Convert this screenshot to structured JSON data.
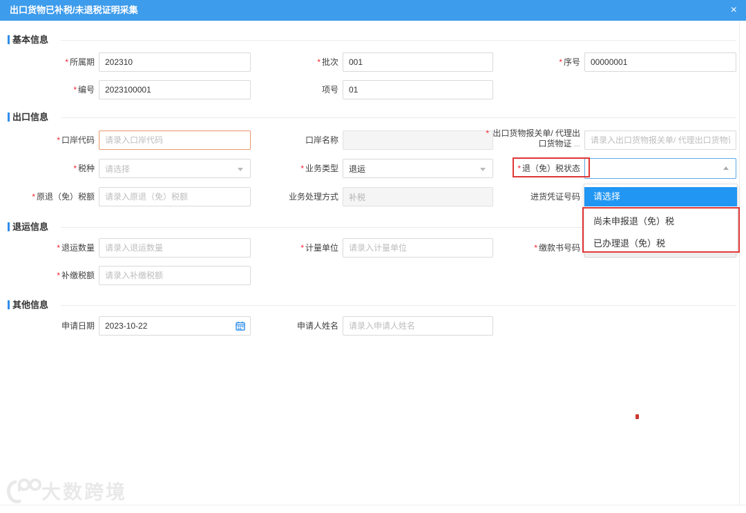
{
  "header": {
    "title": "出口货物已补税/未退税证明采集",
    "close_icon": "×"
  },
  "sections": {
    "basic": "基本信息",
    "export": "出口信息",
    "return": "退运信息",
    "other": "其他信息"
  },
  "fields": {
    "period": {
      "label": "所属期",
      "value": "202310"
    },
    "batch": {
      "label": "批次",
      "value": "001"
    },
    "seq": {
      "label": "序号",
      "value": "00000001"
    },
    "number": {
      "label": "编号",
      "value": "2023100001"
    },
    "item_no": {
      "label": "项号",
      "value": "01"
    },
    "port_code": {
      "label": "口岸代码",
      "placeholder": "请录入口岸代码"
    },
    "port_name": {
      "label": "口岸名称"
    },
    "declaration": {
      "label_line1": "出口货物报关单/ 代理出",
      "label_line2": "口货物证",
      "label_ellipsis": "...",
      "placeholder": "请录入出口货物报关单/ 代理出口货物证明号"
    },
    "tax_type": {
      "label": "税种",
      "placeholder": "请选择"
    },
    "business_type": {
      "label": "业务类型",
      "value": "退运"
    },
    "refund_status": {
      "label": "退（免）税状态"
    },
    "original_refund": {
      "label": "原退（免）税额",
      "placeholder": "请录入原退（免）税额"
    },
    "business_process": {
      "label": "业务处理方式",
      "value": "补税"
    },
    "purchase_voucher": {
      "label": "进货凭证号码"
    },
    "return_qty": {
      "label": "退运数量",
      "placeholder": "请录入退运数量"
    },
    "unit": {
      "label": "计量单位",
      "placeholder": "请录入计量单位"
    },
    "payment_no": {
      "label": "缴款书号码"
    },
    "supplement_tax": {
      "label": "补缴税额",
      "placeholder": "请录入补缴税额"
    },
    "apply_date": {
      "label": "申请日期",
      "value": "2023-10-22"
    },
    "applicant": {
      "label": "申请人姓名",
      "placeholder": "请录入申请人姓名"
    }
  },
  "dropdown": {
    "options": [
      "请选择",
      "尚未申报退（免）税",
      "已办理退（免）税"
    ],
    "selected": "请选择"
  },
  "watermark": {
    "text": "大数跨境"
  },
  "colors": {
    "header_blue": "#3e9cec",
    "section_bar_blue": "#2e8ded",
    "dropdown_active_blue": "#2196f3",
    "annotation_red": "#e03434",
    "focus_orange": "#e9966a",
    "open_select_blue": "#59a8e6"
  }
}
